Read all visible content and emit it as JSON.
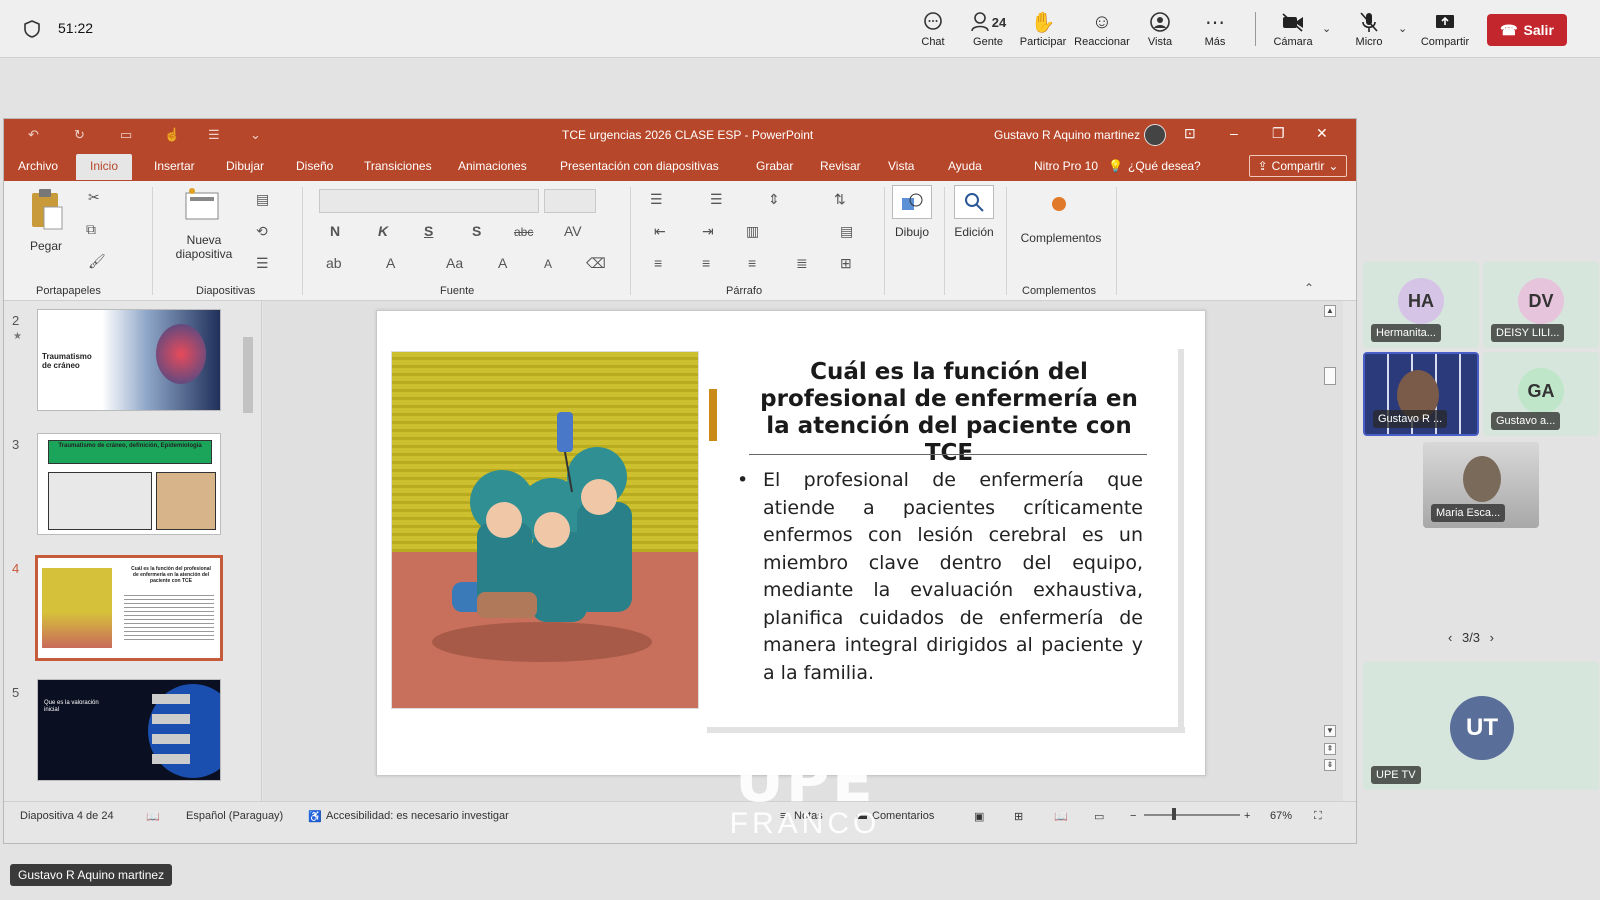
{
  "meeting": {
    "timer": "51:22",
    "controls": [
      {
        "label": "Chat",
        "icon": "chat-icon"
      },
      {
        "label": "Gente",
        "icon": "people-icon",
        "count": "24"
      },
      {
        "label": "Participar",
        "icon": "raise-hand-icon"
      },
      {
        "label": "Reaccionar",
        "icon": "emoji-icon"
      },
      {
        "label": "Vista",
        "icon": "view-icon"
      },
      {
        "label": "Más",
        "icon": "more-icon"
      },
      {
        "label": "Cámara",
        "icon": "camera-off-icon"
      },
      {
        "label": "Micro",
        "icon": "mic-off-icon"
      },
      {
        "label": "Compartir",
        "icon": "share-screen-icon"
      }
    ],
    "leave_label": "Salir",
    "leave_color": "#c4262e"
  },
  "ppt": {
    "doc_title": "TCE  urgencias 2026 CLASE ESP  -  PowerPoint",
    "user": "Gustavo R Aquino martinez",
    "accent": "#b7472a",
    "tabs": [
      "Archivo",
      "Inicio",
      "Insertar",
      "Dibujar",
      "Diseño",
      "Transiciones",
      "Animaciones",
      "Presentación con diapositivas",
      "Grabar",
      "Revisar",
      "Vista",
      "Ayuda",
      "Nitro Pro 10"
    ],
    "active_tab": "Inicio",
    "tell_me": "¿Qué desea?",
    "share_label": "Compartir",
    "ribbon": {
      "paste": "Pegar",
      "new_slide": "Nueva diapositiva",
      "draw": "Dibujo",
      "edit": "Edición",
      "addins": "Complementos",
      "bold": "N",
      "italic": "K",
      "underline": "S",
      "shadow": "S",
      "strike": "abc",
      "groups": [
        "Portapapeles",
        "Diapositivas",
        "Fuente",
        "Párrafo",
        "Complementos"
      ]
    },
    "thumbs": [
      {
        "num": "2",
        "star": "★",
        "title": "Traumatismo de cráneo"
      },
      {
        "num": "3",
        "title": "Traumatismo de cráneo, definición, Epidemiología"
      },
      {
        "num": "4",
        "title": "Cuál es la función del profesional de enfermería en la atención del paciente con TCE"
      },
      {
        "num": "5",
        "title": "Que es la valoración inicial"
      }
    ],
    "slide": {
      "title": "Cuál es la función del profesional de enfermería en la atención del paciente con TCE",
      "body": "El profesional de enfermería que atiende a pacientes críticamente enfermos con lesión cerebral es un miembro clave dentro del equipo, mediante la evaluación exhaustiva, planifica cuidados de enfermería de manera integral dirigidos al paciente y a la familia."
    },
    "status": {
      "slide_of": "Diapositiva 4 de 24",
      "language": "Español (Paraguay)",
      "accessibility": "Accesibilidad: es necesario investigar",
      "notes": "Notas",
      "comments": "Comentarios",
      "zoom": "67%"
    }
  },
  "watermark": {
    "line1": "UPE",
    "line2": "FRANCO"
  },
  "participants": [
    {
      "initials": "HA",
      "name": "Hermanita...",
      "color": "#d6c4e6"
    },
    {
      "initials": "DV",
      "name": "DEISY LILI...",
      "color": "#e6c4dc"
    },
    {
      "initials": "",
      "name": "Gustavo R ...",
      "color": "#3a4a8a"
    },
    {
      "initials": "GA",
      "name": "Gustavo a...",
      "color": "#bfe6c8"
    },
    {
      "initials": "",
      "name": "Maria Esca...",
      "color": "#8a8a8a"
    },
    {
      "initials": "UT",
      "name": "UPE TV",
      "color": "#5a6e9a"
    }
  ],
  "pager": "3/3",
  "presenter_name": "Gustavo R Aquino martinez"
}
